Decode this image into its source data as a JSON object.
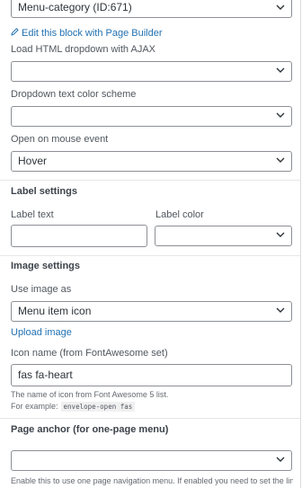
{
  "menu_category": {
    "value": "Menu-category (ID:671)"
  },
  "edit_link": {
    "label": "Edit this block with Page Builder"
  },
  "load_html": {
    "label": "Load HTML dropdown with AJAX",
    "value": ""
  },
  "dropdown_color": {
    "label": "Dropdown text color scheme",
    "value": ""
  },
  "open_event": {
    "label": "Open on mouse event",
    "value": "Hover"
  },
  "label_settings": {
    "title": "Label settings",
    "label_text": {
      "label": "Label text",
      "value": ""
    },
    "label_color": {
      "label": "Label color",
      "value": ""
    }
  },
  "image_settings": {
    "title": "Image settings",
    "use_image_as": {
      "label": "Use image as",
      "value": "Menu item icon"
    },
    "upload_image": "Upload image",
    "icon_name": {
      "label": "Icon name (from FontAwesome set)",
      "value": "fas fa-heart"
    },
    "help_line1": "The name of icon from Font Awesome 5 list.",
    "help_line2": "For example:",
    "help_example": "envelope-open fas"
  },
  "page_anchor": {
    "title": "Page anchor (for one-page menu)",
    "value": "",
    "help": "Enable this to use one page navigation menu. If enabled you need to set the link"
  },
  "icons": {
    "chevron": "chevron-down-icon",
    "edit": "pencil-icon"
  }
}
